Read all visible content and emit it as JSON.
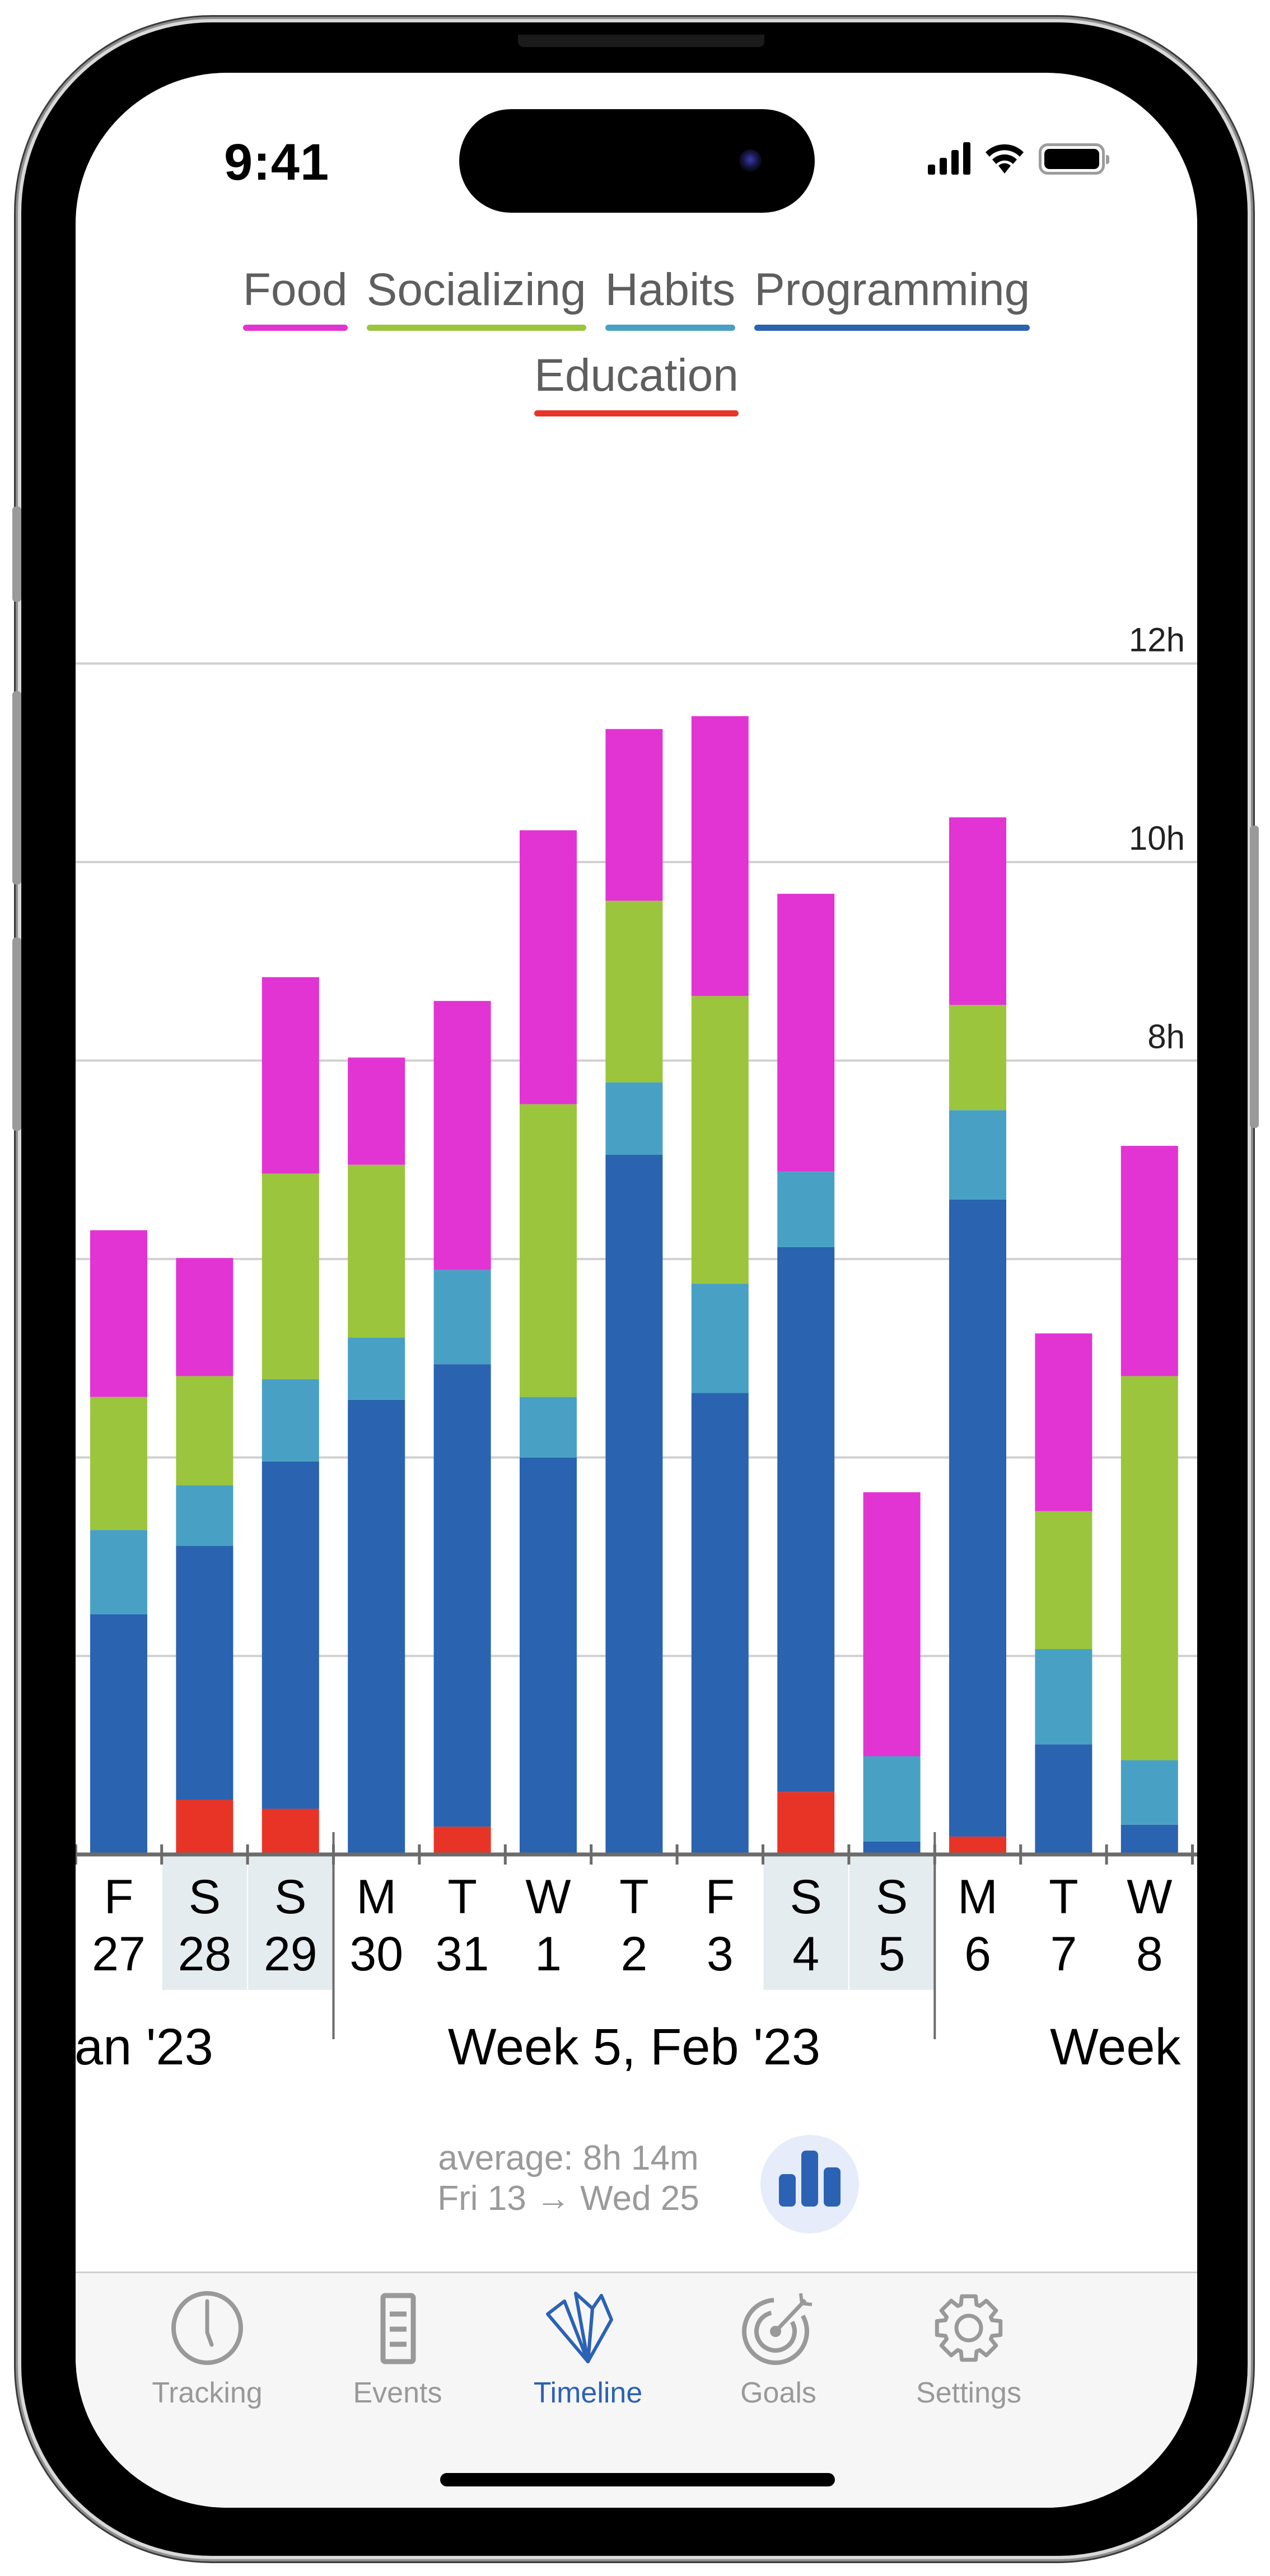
{
  "status_bar": {
    "time": "9:41",
    "signal_icon": "cellular-signal-icon",
    "wifi_icon": "wifi-icon",
    "battery_icon": "battery-icon"
  },
  "legend": [
    {
      "label": "Food",
      "color": "#e233d3"
    },
    {
      "label": "Socializing",
      "color": "#9bc53d"
    },
    {
      "label": "Habits",
      "color": "#48a1c4"
    },
    {
      "label": "Programming",
      "color": "#2a63b0"
    },
    {
      "label": "Education",
      "color": "#e83426"
    }
  ],
  "chart_data": {
    "type": "bar",
    "stacked": true,
    "title": "",
    "xlabel": "",
    "ylabel": "",
    "y_unit": "h",
    "ylim": [
      0,
      12
    ],
    "yticks": [
      {
        "value": 12,
        "label": "12h"
      },
      {
        "value": 10,
        "label": "10h"
      },
      {
        "value": 8,
        "label": "8h"
      },
      {
        "value": 6,
        "label": ""
      },
      {
        "value": 4,
        "label": ""
      },
      {
        "value": 2,
        "label": ""
      }
    ],
    "grid": true,
    "legend_position": "top",
    "categories": [
      {
        "day": "F",
        "date": "27",
        "weekend": false
      },
      {
        "day": "S",
        "date": "28",
        "weekend": true
      },
      {
        "day": "S",
        "date": "29",
        "weekend": true
      },
      {
        "day": "M",
        "date": "30",
        "weekend": false
      },
      {
        "day": "T",
        "date": "31",
        "weekend": false
      },
      {
        "day": "W",
        "date": "1",
        "weekend": false
      },
      {
        "day": "T",
        "date": "2",
        "weekend": false
      },
      {
        "day": "F",
        "date": "3",
        "weekend": false
      },
      {
        "day": "S",
        "date": "4",
        "weekend": true
      },
      {
        "day": "S",
        "date": "5",
        "weekend": true
      },
      {
        "day": "M",
        "date": "6",
        "weekend": false
      },
      {
        "day": "T",
        "date": "7",
        "weekend": false
      },
      {
        "day": "W",
        "date": "8",
        "weekend": false
      }
    ],
    "series": [
      {
        "name": "Education",
        "color": "#e83426",
        "values": [
          0,
          0.55,
          0.46,
          0,
          0.28,
          0,
          0,
          0,
          0.63,
          0,
          0.18,
          0,
          0
        ]
      },
      {
        "name": "Programming",
        "color": "#2a63b0",
        "values": [
          2.42,
          2.56,
          3.5,
          4.58,
          4.66,
          4.0,
          7.05,
          4.65,
          5.49,
          0.13,
          6.42,
          1.11,
          0.3
        ]
      },
      {
        "name": "Habits",
        "color": "#48a1c4",
        "values": [
          0.85,
          0.61,
          0.83,
          0.63,
          0.95,
          0.61,
          0.73,
          1.1,
          0.76,
          0.86,
          0.9,
          0.96,
          0.65
        ]
      },
      {
        "name": "Socializing",
        "color": "#9bc53d",
        "values": [
          1.34,
          1.1,
          2.07,
          1.74,
          0,
          2.95,
          1.83,
          2.9,
          0,
          0,
          1.06,
          1.39,
          3.87
        ]
      },
      {
        "name": "Food",
        "color": "#e233d3",
        "values": [
          1.68,
          1.19,
          1.98,
          1.08,
          2.71,
          2.76,
          1.73,
          2.82,
          2.8,
          2.66,
          1.89,
          1.79,
          2.32
        ]
      }
    ],
    "week_groups": [
      {
        "label": "an '23",
        "start_index": 0,
        "end_index": 2,
        "truncated": "left"
      },
      {
        "label": "Week 5, Feb '23",
        "start_index": 3,
        "end_index": 9
      },
      {
        "label": "Week",
        "start_index": 10,
        "end_index": 12,
        "truncated": "right"
      }
    ]
  },
  "summary": {
    "average": "average: 8h 14m",
    "range": "Fri 13 → Wed 25",
    "toggle_icon": "bar-chart-icon"
  },
  "tabs": [
    {
      "label": "Tracking",
      "icon": "clock-icon",
      "active": false
    },
    {
      "label": "Events",
      "icon": "list-document-icon",
      "active": false
    },
    {
      "label": "Timeline",
      "icon": "fan-chart-icon",
      "active": true
    },
    {
      "label": "Goals",
      "icon": "target-icon",
      "active": false
    },
    {
      "label": "Settings",
      "icon": "gear-icon",
      "active": false
    }
  ],
  "colors": {
    "accent": "#2b62b4",
    "tab_inactive": "#999999",
    "weekend_shade": "#e5ecef",
    "grid": "#d0d0d0"
  }
}
